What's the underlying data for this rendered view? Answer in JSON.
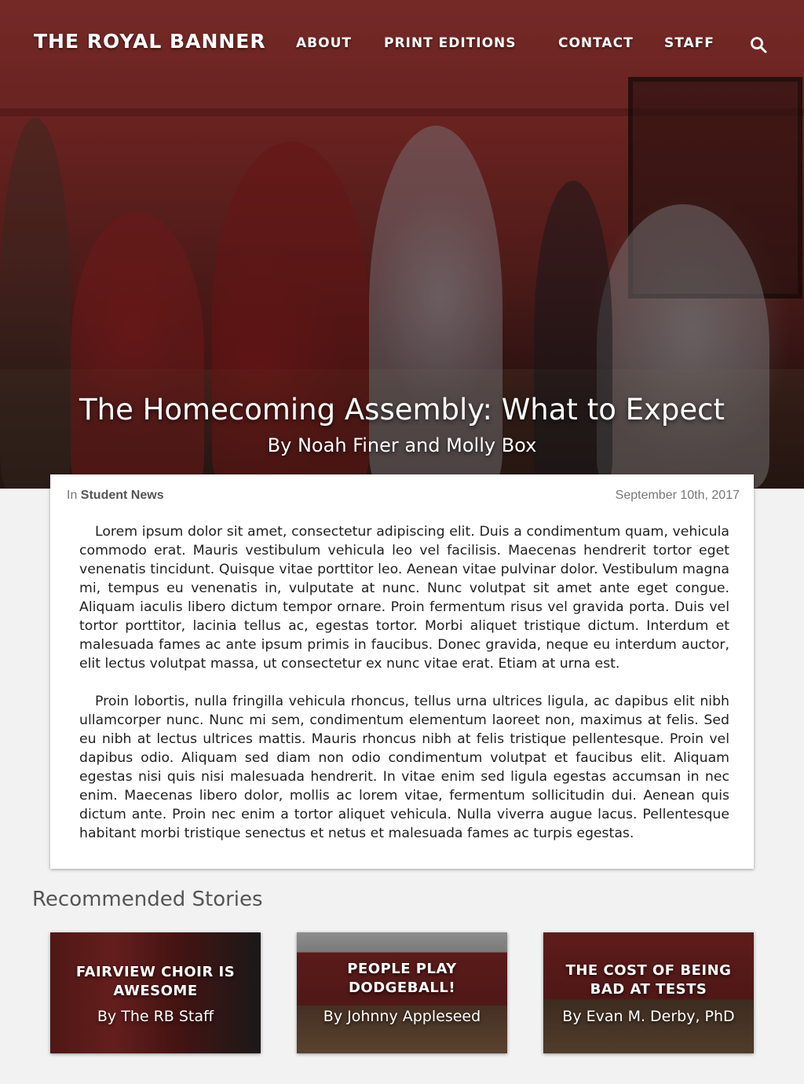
{
  "site": {
    "brand": "THE ROYAL BANNER"
  },
  "nav": {
    "items": [
      {
        "label": "ABOUT"
      },
      {
        "label": "PRINT EDITIONS"
      },
      {
        "label": "CONTACT"
      },
      {
        "label": "STAFF"
      }
    ],
    "search_icon": "search-icon"
  },
  "hero": {
    "title": "The Homecoming Assembly: What to Expect",
    "byline": "By Noah Finer and Molly Box"
  },
  "article": {
    "category_prefix": "In",
    "category": "Student News",
    "date": "September 10th, 2017",
    "paragraphs": [
      "Lorem ipsum dolor sit amet, consectetur adipiscing elit. Duis a condimentum quam, vehicula commodo erat. Mauris vestibulum vehicula leo vel facilisis. Maecenas hendrerit tortor eget venenatis tincidunt. Quisque vitae porttitor leo. Aenean vitae pulvinar dolor. Vestibulum magna mi, tempus eu venenatis in, vulputate at nunc. Nunc volutpat sit amet ante eget congue. Aliquam iaculis libero dictum tempor ornare. Proin fermentum risus vel gravida porta. Duis vel tortor porttitor, lacinia tellus ac, egestas tortor. Morbi aliquet tristique dictum. Interdum et malesuada fames ac ante ipsum primis in faucibus. Donec gravida, neque eu interdum auctor, elit lectus volutpat massa, ut consectetur ex nunc vitae erat. Etiam at urna est.",
      "Proin lobortis, nulla fringilla vehicula rhoncus, tellus urna ultrices ligula, ac dapibus elit nibh ullamcorper nunc. Nunc mi sem, condimentum elementum laoreet non, maximus at felis. Sed eu nibh at lectus ultrices mattis. Mauris rhoncus nibh at felis tristique pellentesque. Proin vel dapibus odio. Aliquam sed diam non odio condimentum volutpat et faucibus elit. Aliquam egestas nisi quis nisi malesuada hendrerit. In vitae enim sed ligula egestas accumsan in nec enim. Maecenas libero dolor, mollis ac lorem vitae, fermentum sollicitudin dui. Aenean quis dictum ante. Proin nec enim a tortor aliquet vehicula. Nulla viverra augue lacus. Pellentesque habitant morbi tristique senectus et netus et malesuada fames ac turpis egestas."
    ]
  },
  "recommended": {
    "heading": "Recommended Stories",
    "stories": [
      {
        "title": "FAIRVIEW CHOIR IS AWESOME",
        "byline": "By The RB Staff"
      },
      {
        "title": "PEOPLE PLAY DODGEBALL!",
        "byline": "By Johnny Appleseed"
      },
      {
        "title": "THE COST OF BEING BAD AT TESTS",
        "byline": "By Evan M. Derby, PhD"
      }
    ]
  },
  "colors": {
    "page_bg": "#f2f2f2",
    "hero_red": "#8f2f2c",
    "text": "#222222",
    "muted": "#777777"
  }
}
